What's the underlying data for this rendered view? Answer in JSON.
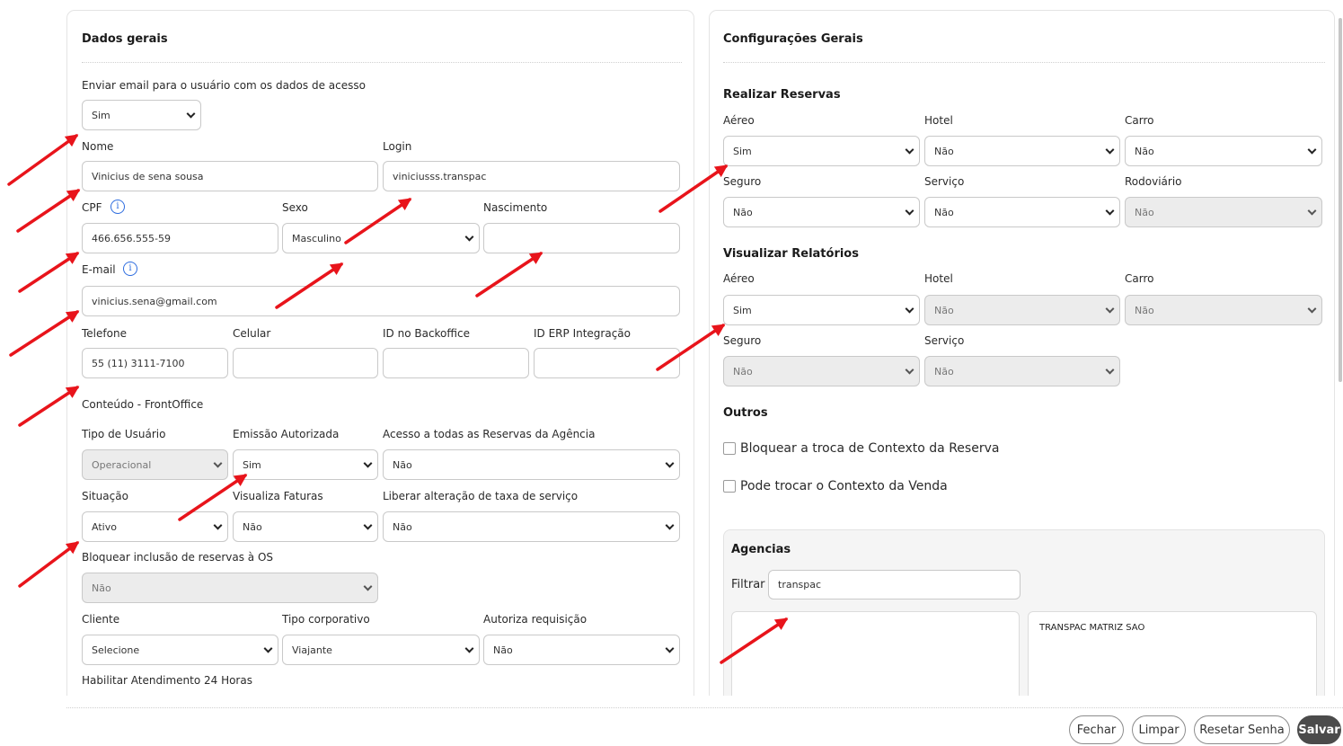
{
  "left": {
    "title": "Dados gerais",
    "send_email": {
      "label": "Enviar email para o usuário com os dados de acesso",
      "value": "Sim"
    },
    "nome": {
      "label": "Nome",
      "value": "Vinicius de sena sousa"
    },
    "login": {
      "label": "Login",
      "value": "viniciusss.transpac"
    },
    "cpf": {
      "label": "CPF",
      "value": "466.656.555-59"
    },
    "sexo": {
      "label": "Sexo",
      "value": "Masculino"
    },
    "nascimento": {
      "label": "Nascimento",
      "value": ""
    },
    "email": {
      "label": "E-mail",
      "value": "vinicius.sena@gmail.com"
    },
    "telefone": {
      "label": "Telefone",
      "value": "55 (11) 3111-7100"
    },
    "celular": {
      "label": "Celular",
      "value": ""
    },
    "id_backoffice": {
      "label": "ID no Backoffice",
      "value": ""
    },
    "id_erp": {
      "label": "ID ERP Integração",
      "value": ""
    },
    "frontoffice_title": "Conteúdo - FrontOffice",
    "tipo_usuario": {
      "label": "Tipo de Usuário",
      "value": "Operacional"
    },
    "emissao_autorizada": {
      "label": "Emissão Autorizada",
      "value": "Sim"
    },
    "acesso_reservas": {
      "label": "Acesso a todas as Reservas da Agência",
      "value": "Não"
    },
    "situacao": {
      "label": "Situação",
      "value": "Ativo"
    },
    "visualiza_faturas": {
      "label": "Visualiza Faturas",
      "value": "Não"
    },
    "liberar_taxa": {
      "label": "Liberar alteração de taxa de serviço",
      "value": "Não"
    },
    "bloquear_inclusao": {
      "label": "Bloquear inclusão de reservas à OS",
      "value": "Não"
    },
    "cliente": {
      "label": "Cliente",
      "value": "Selecione"
    },
    "tipo_corporativo": {
      "label": "Tipo corporativo",
      "value": "Viajante"
    },
    "autoriza_requisicao": {
      "label": "Autoriza requisição",
      "value": "Não"
    },
    "atendimento_24h_label": "Habilitar Atendimento 24 Horas"
  },
  "right": {
    "title": "Configurações Gerais",
    "realizar": {
      "title": "Realizar Reservas",
      "aereo": {
        "label": "Aéreo",
        "value": "Sim"
      },
      "hotel": {
        "label": "Hotel",
        "value": "Não"
      },
      "carro": {
        "label": "Carro",
        "value": "Não"
      },
      "seguro": {
        "label": "Seguro",
        "value": "Não"
      },
      "servico": {
        "label": "Serviço",
        "value": "Não"
      },
      "rodoviario": {
        "label": "Rodoviário",
        "value": "Não"
      }
    },
    "visualizar": {
      "title": "Visualizar Relatórios",
      "aereo": {
        "label": "Aéreo",
        "value": "Sim"
      },
      "hotel": {
        "label": "Hotel",
        "value": "Não"
      },
      "carro": {
        "label": "Carro",
        "value": "Não"
      },
      "seguro": {
        "label": "Seguro",
        "value": "Não"
      },
      "servico": {
        "label": "Serviço",
        "value": "Não"
      }
    },
    "outros": {
      "title": "Outros",
      "bloquear_contexto": "Bloquear a troca de Contexto da Reserva",
      "trocar_contexto": "Pode trocar o Contexto da Venda"
    },
    "agencias": {
      "title": "Agencias",
      "filter_label": "Filtrar",
      "filter_value": "transpac",
      "selected": [
        "TRANSPAC MATRIZ SAO"
      ]
    }
  },
  "footer": {
    "fechar": "Fechar",
    "limpar": "Limpar",
    "resetar": "Resetar Senha",
    "salvar": "Salvar"
  },
  "icons": {
    "info": "info-icon",
    "dropdown": "chevron-down-icon",
    "annotation": "red-arrow-annotation"
  },
  "colors": {
    "annotation_red": "#e8141b",
    "info_blue": "#2d6cdf",
    "primary_dark": "#4b4b4b"
  }
}
